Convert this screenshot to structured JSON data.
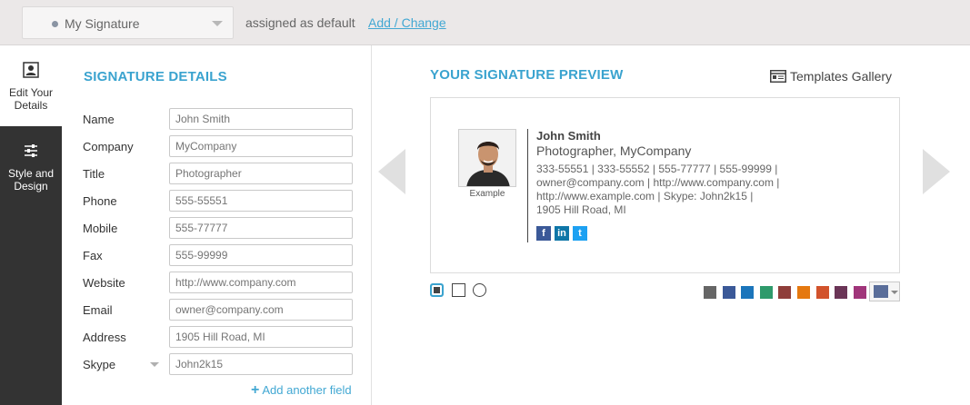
{
  "topbar": {
    "selected_signature": "My Signature",
    "assigned_text": "assigned as default",
    "add_change_link": "Add / Change"
  },
  "nav": {
    "items": [
      {
        "label_line1": "Edit Your",
        "label_line2": "Details",
        "icon": "user-card-icon",
        "active": true
      },
      {
        "label_line1": "Style and",
        "label_line2": "Design",
        "icon": "sliders-icon",
        "active": false
      }
    ]
  },
  "details": {
    "title": "SIGNATURE DETAILS",
    "fields": [
      {
        "label": "Name",
        "placeholder": "John Smith"
      },
      {
        "label": "Company",
        "placeholder": "MyCompany"
      },
      {
        "label": "Title",
        "placeholder": "Photographer"
      },
      {
        "label": "Phone",
        "placeholder": "555-55551"
      },
      {
        "label": "Mobile",
        "placeholder": "555-77777"
      },
      {
        "label": "Fax",
        "placeholder": "555-99999"
      },
      {
        "label": "Website",
        "placeholder": "http://www.company.com"
      },
      {
        "label": "Email",
        "placeholder": "owner@company.com"
      },
      {
        "label": "Address",
        "placeholder": "1905 Hill Road, MI"
      },
      {
        "label": "Skype",
        "placeholder": "John2k15"
      }
    ],
    "add_field_label": "Add another field"
  },
  "preview": {
    "title": "YOUR SIGNATURE PREVIEW",
    "gallery_label": "Templates Gallery",
    "photo_caption": "Example",
    "name": "John Smith",
    "title_company": "Photographer, MyCompany",
    "lines": [
      "333-55551 | 333-55552 | 555-77777 | 555-99999 |",
      "owner@company.com | http://www.company.com |",
      "http://www.example.com | Skype: John2k15 |",
      "1905 Hill Road, MI"
    ],
    "social": {
      "facebook": "f",
      "linkedin": "in",
      "twitter": "t"
    },
    "colors": [
      "#666666",
      "#3b5998",
      "#1b75bb",
      "#2e9a6b",
      "#8f3e3a",
      "#e5780f",
      "#d2532c",
      "#6b3557",
      "#a0357a"
    ],
    "selected_color": "#5a6e9a"
  }
}
